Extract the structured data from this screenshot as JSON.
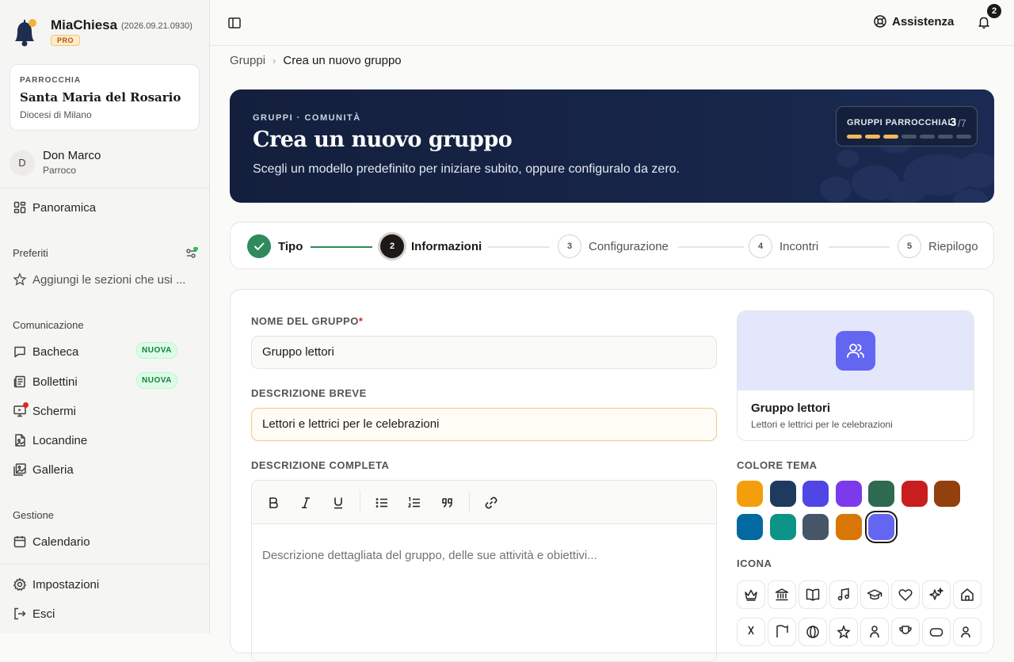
{
  "app": {
    "name": "MiaChiesa",
    "version": "(2026.09.21.0930)",
    "plan": "PRO"
  },
  "parish": {
    "label": "PARROCCHIA",
    "name": "Santa Maria del Rosario",
    "diocese": "Diocesi di Milano"
  },
  "user": {
    "initial": "D",
    "name": "Don Marco",
    "role": "Parroco"
  },
  "nav": {
    "overview": "Panoramica",
    "favorites_title": "Preferiti",
    "favorites_hint": "Aggiungi le sezioni che usi ...",
    "communication_title": "Comunicazione",
    "communication": [
      {
        "label": "Bacheca",
        "badge": "NUOVA"
      },
      {
        "label": "Bollettini",
        "badge": "NUOVA"
      },
      {
        "label": "Schermi"
      },
      {
        "label": "Locandine"
      },
      {
        "label": "Galleria"
      }
    ],
    "management_title": "Gestione",
    "management": [
      {
        "label": "Calendario"
      }
    ],
    "settings": "Impostazioni",
    "logout": "Esci"
  },
  "topbar": {
    "help": "Assistenza",
    "notifications": "2"
  },
  "breadcrumb": {
    "parent": "Gruppi",
    "current": "Crea un nuovo gruppo"
  },
  "hero": {
    "kicker": "GRUPPI · COMUNITÀ",
    "title": "Crea un nuovo gruppo",
    "subtitle": "Scegli un modello predefinito per iniziare subito, oppure configuralo da zero.",
    "counter_label": "GRUPPI PARROCCHIALI",
    "counter_value": "3",
    "counter_total": "/7",
    "counter_used": 3,
    "counter_max": 7
  },
  "steps": [
    {
      "num": "✓",
      "label": "Tipo",
      "state": "done"
    },
    {
      "num": "2",
      "label": "Informazioni",
      "state": "active"
    },
    {
      "num": "3",
      "label": "Configurazione",
      "state": "todo"
    },
    {
      "num": "4",
      "label": "Incontri",
      "state": "todo"
    },
    {
      "num": "5",
      "label": "Riepilogo",
      "state": "todo"
    }
  ],
  "form": {
    "name_label": "NOME DEL GRUPPO",
    "name_required": "*",
    "name_value": "Gruppo lettori",
    "short_label": "DESCRIZIONE BREVE",
    "short_value": "Lettori e lettrici per le celebrazioni",
    "full_label": "DESCRIZIONE COMPLETA",
    "full_placeholder": "Descrizione dettagliata del gruppo, delle sue attività e obiettivi..."
  },
  "preview": {
    "name": "Gruppo lettori",
    "description": "Lettori e lettrici per le celebrazioni",
    "color": "#6366f1"
  },
  "theme": {
    "label": "COLORE TEMA",
    "colors": [
      "#f59e0b",
      "#1e3a5f",
      "#4f46e5",
      "#7c3aed",
      "#2d6a4f",
      "#c81e1e",
      "#92400e",
      "#0369a1",
      "#0d9488",
      "#475569",
      "#d97706",
      "#6366f1"
    ],
    "selected": "#6366f1"
  },
  "icons": {
    "label": "ICONA",
    "row1": [
      "crown-icon",
      "bank-icon",
      "book-icon",
      "music-icon",
      "graduation-cap-icon",
      "heart-icon",
      "sparkles-icon",
      "home-icon"
    ]
  }
}
